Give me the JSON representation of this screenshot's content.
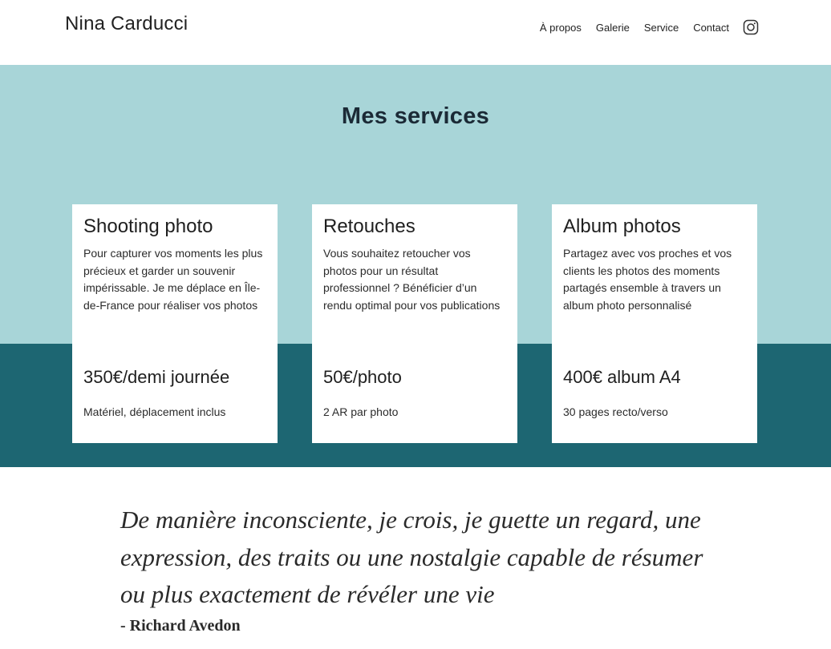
{
  "header": {
    "brand": "Nina Carducci",
    "nav": [
      "À propos",
      "Galerie",
      "Service",
      "Contact"
    ],
    "instagram_icon": "instagram-icon"
  },
  "services": {
    "title": "Mes services",
    "colors": {
      "top_band": "#a8d5d8",
      "bottom_band": "#1d6672"
    },
    "cards": [
      {
        "title": "Shooting photo",
        "description": "Pour capturer vos moments les plus précieux et garder un souvenir impérissable. Je me déplace en Île-de-France pour réaliser vos photos",
        "price": "350€/demi journée",
        "note": "Matériel, déplacement inclus"
      },
      {
        "title": "Retouches",
        "description": "Vous souhaitez retoucher vos photos pour un résultat professionnel ? Bénéficier d’un rendu optimal pour vos publications",
        "price": "50€/photo",
        "note": "2 AR par photo"
      },
      {
        "title": "Album photos",
        "description": "Partagez avec vos proches et vos clients les photos des moments partagés ensemble à travers un album photo personnalisé",
        "price": "400€ album A4",
        "note": "30 pages recto/verso"
      }
    ]
  },
  "quote": {
    "text": "De manière inconsciente, je crois, je guette un regard, une expression, des traits ou une nostalgie capable de résumer ou plus exactement de révéler une vie",
    "author": "- Richard Avedon"
  }
}
